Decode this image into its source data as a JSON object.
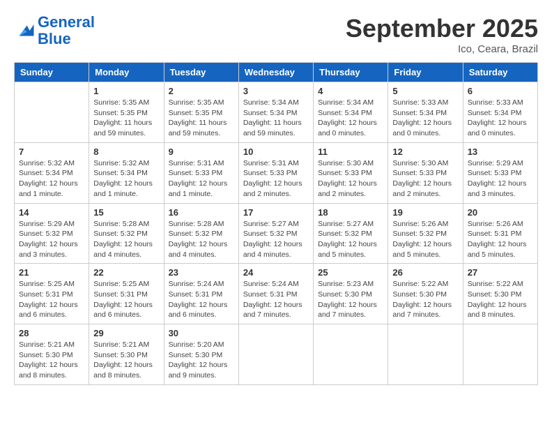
{
  "logo": {
    "general": "General",
    "blue": "Blue"
  },
  "title": "September 2025",
  "subtitle": "Ico, Ceara, Brazil",
  "days_of_week": [
    "Sunday",
    "Monday",
    "Tuesday",
    "Wednesday",
    "Thursday",
    "Friday",
    "Saturday"
  ],
  "weeks": [
    [
      {
        "day": "",
        "info": ""
      },
      {
        "day": "1",
        "info": "Sunrise: 5:35 AM\nSunset: 5:35 PM\nDaylight: 11 hours\nand 59 minutes."
      },
      {
        "day": "2",
        "info": "Sunrise: 5:35 AM\nSunset: 5:35 PM\nDaylight: 11 hours\nand 59 minutes."
      },
      {
        "day": "3",
        "info": "Sunrise: 5:34 AM\nSunset: 5:34 PM\nDaylight: 11 hours\nand 59 minutes."
      },
      {
        "day": "4",
        "info": "Sunrise: 5:34 AM\nSunset: 5:34 PM\nDaylight: 12 hours\nand 0 minutes."
      },
      {
        "day": "5",
        "info": "Sunrise: 5:33 AM\nSunset: 5:34 PM\nDaylight: 12 hours\nand 0 minutes."
      },
      {
        "day": "6",
        "info": "Sunrise: 5:33 AM\nSunset: 5:34 PM\nDaylight: 12 hours\nand 0 minutes."
      }
    ],
    [
      {
        "day": "7",
        "info": "Sunrise: 5:32 AM\nSunset: 5:34 PM\nDaylight: 12 hours\nand 1 minute."
      },
      {
        "day": "8",
        "info": "Sunrise: 5:32 AM\nSunset: 5:34 PM\nDaylight: 12 hours\nand 1 minute."
      },
      {
        "day": "9",
        "info": "Sunrise: 5:31 AM\nSunset: 5:33 PM\nDaylight: 12 hours\nand 1 minute."
      },
      {
        "day": "10",
        "info": "Sunrise: 5:31 AM\nSunset: 5:33 PM\nDaylight: 12 hours\nand 2 minutes."
      },
      {
        "day": "11",
        "info": "Sunrise: 5:30 AM\nSunset: 5:33 PM\nDaylight: 12 hours\nand 2 minutes."
      },
      {
        "day": "12",
        "info": "Sunrise: 5:30 AM\nSunset: 5:33 PM\nDaylight: 12 hours\nand 2 minutes."
      },
      {
        "day": "13",
        "info": "Sunrise: 5:29 AM\nSunset: 5:33 PM\nDaylight: 12 hours\nand 3 minutes."
      }
    ],
    [
      {
        "day": "14",
        "info": "Sunrise: 5:29 AM\nSunset: 5:32 PM\nDaylight: 12 hours\nand 3 minutes."
      },
      {
        "day": "15",
        "info": "Sunrise: 5:28 AM\nSunset: 5:32 PM\nDaylight: 12 hours\nand 4 minutes."
      },
      {
        "day": "16",
        "info": "Sunrise: 5:28 AM\nSunset: 5:32 PM\nDaylight: 12 hours\nand 4 minutes."
      },
      {
        "day": "17",
        "info": "Sunrise: 5:27 AM\nSunset: 5:32 PM\nDaylight: 12 hours\nand 4 minutes."
      },
      {
        "day": "18",
        "info": "Sunrise: 5:27 AM\nSunset: 5:32 PM\nDaylight: 12 hours\nand 5 minutes."
      },
      {
        "day": "19",
        "info": "Sunrise: 5:26 AM\nSunset: 5:32 PM\nDaylight: 12 hours\nand 5 minutes."
      },
      {
        "day": "20",
        "info": "Sunrise: 5:26 AM\nSunset: 5:31 PM\nDaylight: 12 hours\nand 5 minutes."
      }
    ],
    [
      {
        "day": "21",
        "info": "Sunrise: 5:25 AM\nSunset: 5:31 PM\nDaylight: 12 hours\nand 6 minutes."
      },
      {
        "day": "22",
        "info": "Sunrise: 5:25 AM\nSunset: 5:31 PM\nDaylight: 12 hours\nand 6 minutes."
      },
      {
        "day": "23",
        "info": "Sunrise: 5:24 AM\nSunset: 5:31 PM\nDaylight: 12 hours\nand 6 minutes."
      },
      {
        "day": "24",
        "info": "Sunrise: 5:24 AM\nSunset: 5:31 PM\nDaylight: 12 hours\nand 7 minutes."
      },
      {
        "day": "25",
        "info": "Sunrise: 5:23 AM\nSunset: 5:30 PM\nDaylight: 12 hours\nand 7 minutes."
      },
      {
        "day": "26",
        "info": "Sunrise: 5:22 AM\nSunset: 5:30 PM\nDaylight: 12 hours\nand 7 minutes."
      },
      {
        "day": "27",
        "info": "Sunrise: 5:22 AM\nSunset: 5:30 PM\nDaylight: 12 hours\nand 8 minutes."
      }
    ],
    [
      {
        "day": "28",
        "info": "Sunrise: 5:21 AM\nSunset: 5:30 PM\nDaylight: 12 hours\nand 8 minutes."
      },
      {
        "day": "29",
        "info": "Sunrise: 5:21 AM\nSunset: 5:30 PM\nDaylight: 12 hours\nand 8 minutes."
      },
      {
        "day": "30",
        "info": "Sunrise: 5:20 AM\nSunset: 5:30 PM\nDaylight: 12 hours\nand 9 minutes."
      },
      {
        "day": "",
        "info": ""
      },
      {
        "day": "",
        "info": ""
      },
      {
        "day": "",
        "info": ""
      },
      {
        "day": "",
        "info": ""
      }
    ]
  ]
}
